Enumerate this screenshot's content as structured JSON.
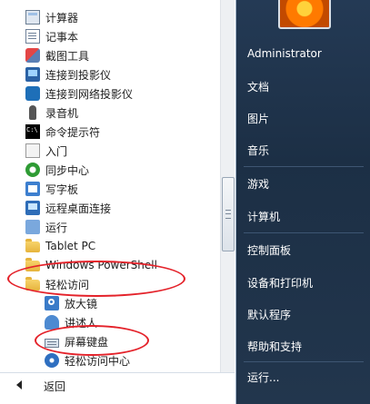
{
  "programs": [
    {
      "label": "计算器",
      "icon": "calculator-icon"
    },
    {
      "label": "记事本",
      "icon": "notepad-icon"
    },
    {
      "label": "截图工具",
      "icon": "snipping-tool-icon"
    },
    {
      "label": "连接到投影仪",
      "icon": "projector-icon"
    },
    {
      "label": "连接到网络投影仪",
      "icon": "network-projector-icon"
    },
    {
      "label": "录音机",
      "icon": "microphone-icon"
    },
    {
      "label": "命令提示符",
      "icon": "command-prompt-icon"
    },
    {
      "label": "入门",
      "icon": "getting-started-icon"
    },
    {
      "label": "同步中心",
      "icon": "sync-icon"
    },
    {
      "label": "写字板",
      "icon": "wordpad-icon"
    },
    {
      "label": "远程桌面连接",
      "icon": "remote-desktop-icon"
    },
    {
      "label": "运行",
      "icon": "run-icon"
    },
    {
      "label": "Tablet PC",
      "icon": "folder-icon"
    },
    {
      "label": "Windows PowerShell",
      "icon": "folder-icon"
    },
    {
      "label": "轻松访问",
      "icon": "folder-open-icon"
    },
    {
      "label": "放大镜",
      "icon": "magnifier-icon"
    },
    {
      "label": "讲述人",
      "icon": "narrator-icon"
    },
    {
      "label": "屏幕键盘",
      "icon": "keyboard-icon"
    },
    {
      "label": "轻松访问中心",
      "icon": "ease-of-access-icon"
    }
  ],
  "back_label": "返回",
  "right_menu": {
    "user": "Administrator",
    "items": [
      "文档",
      "图片",
      "音乐",
      "游戏",
      "计算机",
      "控制面板",
      "设备和打印机",
      "默认程序",
      "帮助和支持",
      "运行..."
    ]
  },
  "colors": {
    "annotation": "#e4222a",
    "right_pane": "#1f3349"
  }
}
